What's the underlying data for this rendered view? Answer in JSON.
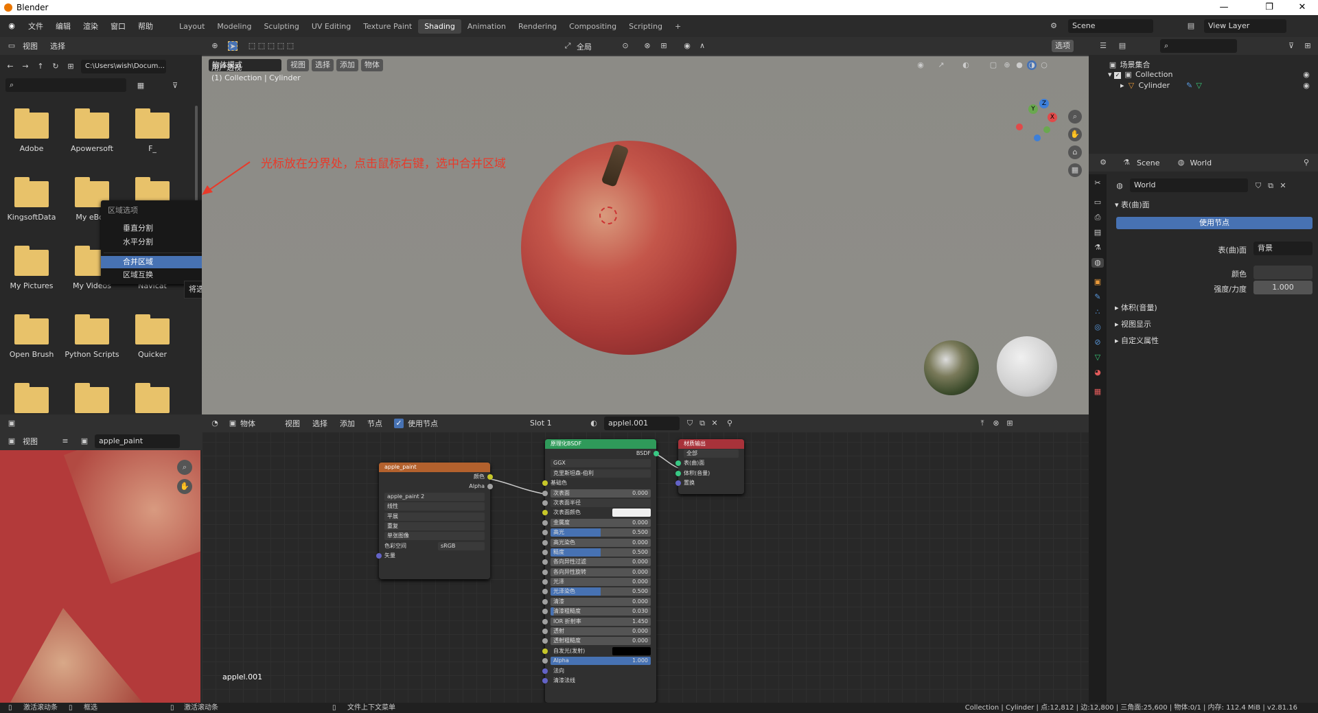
{
  "window": {
    "title": "Blender"
  },
  "topbar": {
    "menus": [
      "文件",
      "编辑",
      "渲染",
      "窗口",
      "帮助"
    ],
    "workspaces": [
      "Layout",
      "Modeling",
      "Sculpting",
      "UV Editing",
      "Texture Paint",
      "Shading",
      "Animation",
      "Rendering",
      "Compositing",
      "Scripting"
    ],
    "active_workspace": "Shading",
    "scene": "Scene",
    "view_layer": "View Layer"
  },
  "filebrowser": {
    "menus": [
      "视图",
      "选择"
    ],
    "path": "C:\\Users\\wish\\Docum...",
    "folders": [
      "Adobe",
      "Apowersoft",
      "F_",
      "KingsoftData",
      "My eBoo",
      "",
      "My Pictures",
      "My Videos",
      "Navicat",
      "Open Brush",
      "Python Scripts",
      "Quicker",
      "",
      "",
      ""
    ]
  },
  "context_menu": {
    "title": "区域选项",
    "items": [
      "垂直分割",
      "水平分割",
      "合并区域",
      "区域互换"
    ],
    "selected": "合并区域",
    "tooltip": "将选定区域合并到新窗口."
  },
  "annotation": {
    "text": "光标放在分界处，点击鼠标右键，选中合并区域",
    "color": "#e83a2a"
  },
  "viewport": {
    "global": "全局",
    "mode": "物体模式",
    "menus": [
      "视图",
      "选择",
      "添加",
      "物体"
    ],
    "options": "选项",
    "view_name": "用户透视",
    "collection_info": "(1) Collection | Cylinder",
    "gizmo": {
      "x": "X",
      "y": "Y",
      "z": "Z"
    }
  },
  "image_editor": {
    "view": "视图",
    "image": "apple_paint",
    "footer_label": "applel.001"
  },
  "node_editor": {
    "object": "物体",
    "menus": [
      "视图",
      "选择",
      "添加",
      "节点"
    ],
    "use_nodes": "使用节点",
    "slot": "Slot 1",
    "material": "applel.001",
    "image_node": {
      "title": "apple_paint",
      "outputs": [
        "颜色",
        "Alpha"
      ],
      "image": "apple_paint",
      "users": "2",
      "dropdowns": [
        "线性",
        "平展",
        "重复",
        "单张图像"
      ],
      "color_space_label": "色彩空间",
      "color_space": "sRGB",
      "input": "矢量"
    },
    "bsdf_node": {
      "title": "原理化BSDF",
      "output": "BSDF",
      "distribution": "GGX",
      "subsurface_method": "克里斯坦森-伯利",
      "base_color": "基础色",
      "rows": [
        {
          "label": "次表面",
          "value": "0.000",
          "fill": 0
        },
        {
          "label": "次表面半径",
          "value": "",
          "fill": 0,
          "dropdown": true
        },
        {
          "label": "次表面颜色",
          "value": "",
          "fill": 0,
          "color": "#f0f0f0"
        },
        {
          "label": "金属度",
          "value": "0.000",
          "fill": 0
        },
        {
          "label": "高光",
          "value": "0.500",
          "fill": 0.5
        },
        {
          "label": "高光染色",
          "value": "0.000",
          "fill": 0
        },
        {
          "label": "糙度",
          "value": "0.500",
          "fill": 0.5
        },
        {
          "label": "各向异性过滤",
          "value": "0.000",
          "fill": 0
        },
        {
          "label": "各向异性旋转",
          "value": "0.000",
          "fill": 0
        },
        {
          "label": "光泽",
          "value": "0.000",
          "fill": 0
        },
        {
          "label": "光泽染色",
          "value": "0.500",
          "fill": 0.5
        },
        {
          "label": "清漆",
          "value": "0.000",
          "fill": 0
        },
        {
          "label": "清漆粗糙度",
          "value": "0.030",
          "fill": 0.03
        },
        {
          "label": "IOR 折射率",
          "value": "1.450",
          "fill": 0
        },
        {
          "label": "透射",
          "value": "0.000",
          "fill": 0
        },
        {
          "label": "透射粗糙度",
          "value": "0.000",
          "fill": 0
        },
        {
          "label": "自发光(发射)",
          "value": "",
          "fill": 0,
          "color": "#000000"
        },
        {
          "label": "Alpha",
          "value": "1.000",
          "fill": 1
        },
        {
          "label": "法向",
          "value": "",
          "fill": 0
        },
        {
          "label": "清漆法线",
          "value": "",
          "fill": 0
        }
      ]
    },
    "output_node": {
      "title": "材质输出",
      "target": "全部",
      "inputs": [
        "表(曲)面",
        "体积(音量)",
        "置换"
      ]
    }
  },
  "outliner": {
    "root": "场景集合",
    "collection": "Collection",
    "object": "Cylinder"
  },
  "properties": {
    "scene": "Scene",
    "world": "World",
    "world_name": "World",
    "surface_panel": "表(曲)面",
    "use_nodes": "使用节点",
    "surface_label": "表(曲)面",
    "surface_value": "背景",
    "color_label": "颜色",
    "strength_label": "强度/力度",
    "strength_value": "1.000",
    "panels": [
      "体积(音量)",
      "视图显示",
      "自定义属性"
    ]
  },
  "statusbar": {
    "left": [
      "激活滚动条",
      "框选",
      "激活滚动条",
      "文件上下文菜单"
    ],
    "right": "Collection | Cylinder | 点:12,812 | 边:12,800 | 三角面:25,600 | 物体:0/1 | 内存: 112.4 MiB | v2.81.16"
  }
}
